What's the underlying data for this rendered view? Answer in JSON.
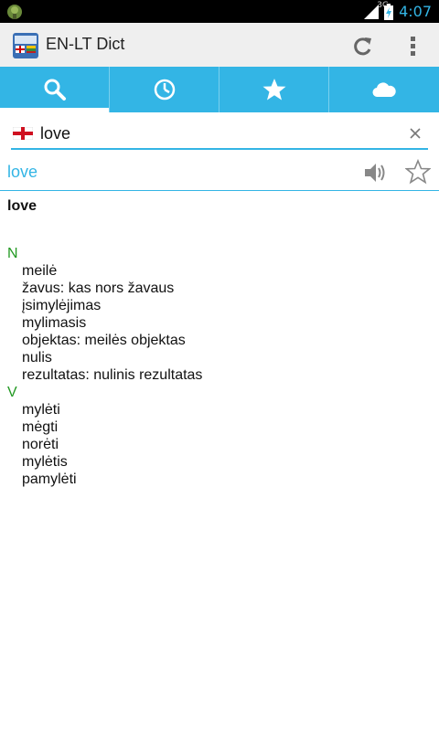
{
  "status_bar": {
    "network": "3G",
    "time": "4:07"
  },
  "action_bar": {
    "title": "EN-LT Dict",
    "icons": [
      "app-logo-icon",
      "refresh-icon",
      "overflow-menu-icon"
    ]
  },
  "tabs": [
    {
      "name": "search",
      "icon": "search-icon",
      "active": true
    },
    {
      "name": "history",
      "icon": "clock-icon",
      "active": false
    },
    {
      "name": "favorites",
      "icon": "star-icon",
      "active": false
    },
    {
      "name": "cloud",
      "icon": "cloud-icon",
      "active": false
    }
  ],
  "search": {
    "value": "love",
    "language_flag": "england-flag-icon"
  },
  "entry": {
    "word": "love",
    "headword": "love",
    "sections": [
      {
        "pos": "N",
        "glosses": [
          "meilė",
          "žavus: kas nors žavaus",
          "įsimylėjimas",
          "mylimasis",
          "objektas: meilės objektas",
          "nulis",
          "rezultatas: nulinis rezultatas"
        ]
      },
      {
        "pos": "V",
        "glosses": [
          "mylėti",
          "mėgti",
          "norėti",
          "mylėtis",
          "pamylėti"
        ]
      }
    ]
  },
  "colors": {
    "accent": "#33b5e5",
    "pos": "#229922",
    "action_bar": "#efefef"
  }
}
